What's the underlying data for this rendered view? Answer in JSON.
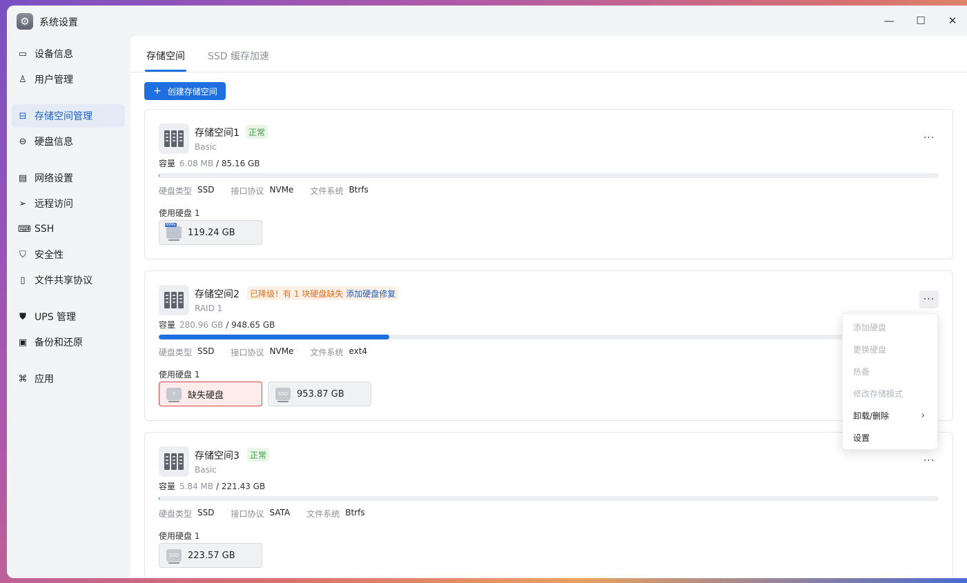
{
  "window": {
    "title": "系统设置"
  },
  "colors": {
    "accent": "#1f6fe0",
    "ok": "#3f9f43",
    "warn": "#e0701f",
    "danger": "#e0444a"
  },
  "sidebar": {
    "items": [
      {
        "label": "设备信息",
        "icon": "monitor-icon"
      },
      {
        "label": "用户管理",
        "icon": "user-icon"
      },
      {
        "label": "存储空间管理",
        "icon": "storage-icon",
        "active": true
      },
      {
        "label": "硬盘信息",
        "icon": "disk-icon"
      },
      {
        "label": "网络设置",
        "icon": "network-icon"
      },
      {
        "label": "远程访问",
        "icon": "send-icon"
      },
      {
        "label": "SSH",
        "icon": "code-icon"
      },
      {
        "label": "安全性",
        "icon": "shield-check-icon"
      },
      {
        "label": "文件共享协议",
        "icon": "file-icon"
      },
      {
        "label": "UPS 管理",
        "icon": "shield-icon"
      },
      {
        "label": "备份和还原",
        "icon": "backup-icon"
      },
      {
        "label": "应用",
        "icon": "command-icon"
      }
    ]
  },
  "tabs": [
    {
      "label": "存储空间",
      "active": true
    },
    {
      "label": "SSD 缓存加速",
      "active": false
    }
  ],
  "create_button": {
    "plus": "+",
    "label": "创建存储空间"
  },
  "common": {
    "capacity_label": "容量",
    "sep": "/",
    "disk_type_label": "硬盘类型",
    "protocol_label": "接口协议",
    "fs_label": "文件系统",
    "used_disks_label": "使用硬盘",
    "more": "···"
  },
  "pools": [
    {
      "name": "存储空间1",
      "status": "正常",
      "status_type": "ok",
      "mode": "Basic",
      "used": "6.08 MB",
      "total": "85.16 GB",
      "usage_fraction": 0.0,
      "disk_type": "SSD",
      "protocol": "NVMe",
      "fs": "Btrfs",
      "disk_count": "1",
      "disks": [
        {
          "label": "119.24 GB",
          "kind": "nvme"
        }
      ]
    },
    {
      "name": "存储空间2",
      "status": "已降级！有 1 块硬盘缺失",
      "status_fix": "添加硬盘修复",
      "status_type": "warn",
      "mode": "RAID 1",
      "used": "280.96 GB",
      "total": "948.65 GB",
      "usage_fraction": 0.296,
      "disk_type": "SSD",
      "protocol": "NVMe",
      "fs": "ext4",
      "disk_count": "1",
      "disks": [
        {
          "label": "缺失硬盘",
          "kind": "missing",
          "glyph": "?"
        },
        {
          "label": "953.87 GB",
          "kind": "ssd",
          "glyph": "SSD"
        }
      ]
    },
    {
      "name": "存储空间3",
      "status": "正常",
      "status_type": "ok",
      "mode": "Basic",
      "used": "5.84 MB",
      "total": "221.43 GB",
      "usage_fraction": 0.0,
      "disk_type": "SSD",
      "protocol": "SATA",
      "fs": "Btrfs",
      "disk_count": "1",
      "disks": [
        {
          "label": "223.57 GB",
          "kind": "ssd",
          "glyph": "SSD"
        }
      ]
    }
  ],
  "dropdown": {
    "items": [
      {
        "label": "添加硬盘",
        "enabled": false
      },
      {
        "label": "更换硬盘",
        "enabled": false
      },
      {
        "label": "热备",
        "enabled": false
      },
      {
        "label": "修改存储模式",
        "enabled": false
      },
      {
        "label": "卸载/删除",
        "enabled": true,
        "submenu": true
      },
      {
        "label": "设置",
        "enabled": true
      }
    ]
  }
}
